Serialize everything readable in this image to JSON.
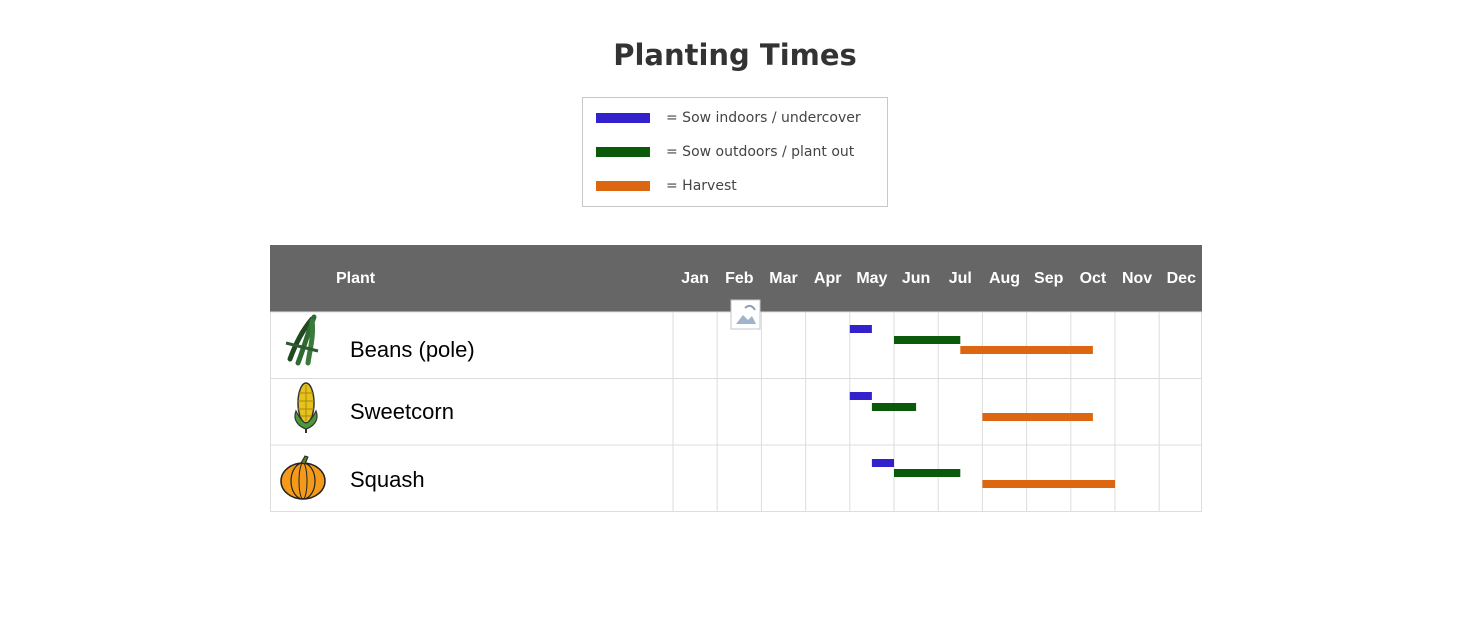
{
  "title": "Planting Times",
  "legend": [
    {
      "label": "= Sow indoors / undercover",
      "color": "#3322cc"
    },
    {
      "label": "= Sow outdoors / plant out",
      "color": "#0a5a0a"
    },
    {
      "label": "= Harvest",
      "color": "#dd6611"
    }
  ],
  "colors": {
    "header_bg": "#666666",
    "grid": "#dddddd",
    "sow_indoors": "#3322cc",
    "sow_outdoors": "#0a5a0a",
    "harvest": "#dd6611"
  },
  "chart_data": {
    "type": "gantt",
    "title": "Planting Times",
    "plant_header": "Plant",
    "months": [
      "Jan",
      "Feb",
      "Mar",
      "Apr",
      "May",
      "Jun",
      "Jul",
      "Aug",
      "Sep",
      "Oct",
      "Nov",
      "Dec"
    ],
    "rows": [
      {
        "plant": "Beans (pole)",
        "icon": "beans-icon",
        "bars": [
          {
            "type": "sow_indoors",
            "start": "May 1",
            "end": "May 15"
          },
          {
            "type": "sow_outdoors",
            "start": "Jun 1",
            "end": "Jul 15"
          },
          {
            "type": "harvest",
            "start": "Jul 15",
            "end": "Oct 15"
          }
        ]
      },
      {
        "plant": "Sweetcorn",
        "icon": "corn-icon",
        "bars": [
          {
            "type": "sow_indoors",
            "start": "May 1",
            "end": "May 15"
          },
          {
            "type": "sow_outdoors",
            "start": "May 15",
            "end": "Jun 15"
          },
          {
            "type": "harvest",
            "start": "Aug 1",
            "end": "Oct 15"
          }
        ]
      },
      {
        "plant": "Squash",
        "icon": "pumpkin-icon",
        "bars": [
          {
            "type": "sow_indoors",
            "start": "May 15",
            "end": "May 31"
          },
          {
            "type": "sow_outdoors",
            "start": "Jun 1",
            "end": "Jul 15"
          },
          {
            "type": "harvest",
            "start": "Aug 1",
            "end": "Oct 31"
          }
        ]
      }
    ]
  }
}
